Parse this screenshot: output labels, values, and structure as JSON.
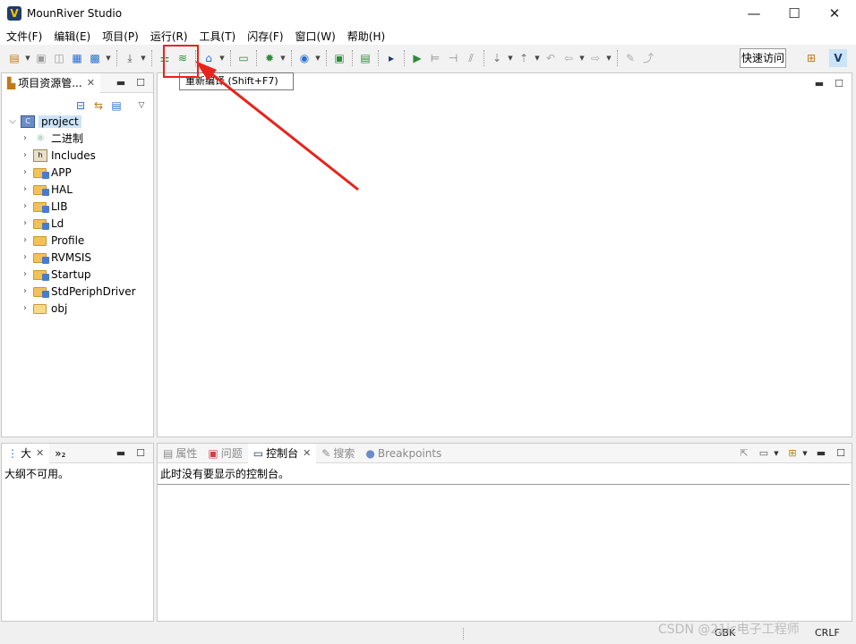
{
  "window": {
    "title": "MounRiver Studio",
    "controls": [
      "—",
      "☐",
      "✕"
    ]
  },
  "menubar": {
    "items": [
      "文件(F)",
      "编辑(E)",
      "项目(P)",
      "运行(R)",
      "工具(T)",
      "闪存(F)",
      "窗口(W)",
      "帮助(H)"
    ]
  },
  "toolbar": {
    "quick_access": "快速访问",
    "tooltip": "重新编译 (Shift+F7)"
  },
  "project_explorer": {
    "tab_label": "项目资源管...",
    "root": "project",
    "items": [
      "二进制",
      "Includes",
      "APP",
      "HAL",
      "LIB",
      "Ld",
      "Profile",
      "RVMSIS",
      "Startup",
      "StdPeriphDriver",
      "obj"
    ]
  },
  "outline": {
    "tab_label": "大",
    "extra_tab": "»₂",
    "message": "大纲不可用。"
  },
  "console": {
    "tabs": [
      "属性",
      "问题",
      "控制台",
      "搜索",
      "Breakpoints"
    ],
    "active_tab": "控制台",
    "message": "此时没有要显示的控制台。"
  },
  "statusbar": {
    "encoding": "GBK",
    "line_ending": "CRLF"
  },
  "watermark": "CSDN @21ic电子工程师",
  "colors": {
    "highlight": "#e8231b",
    "selection": "#cce4f7",
    "folder": "#f2c256"
  }
}
